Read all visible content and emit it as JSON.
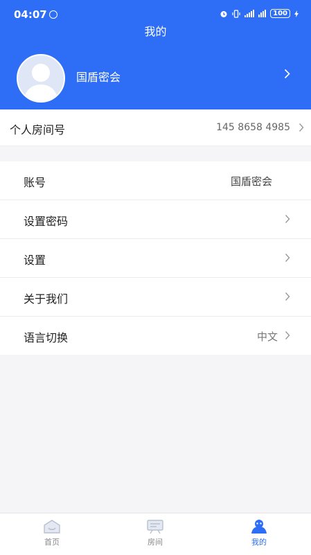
{
  "status_bar": {
    "time": "04:07",
    "battery": "100"
  },
  "header": {
    "title": "我的"
  },
  "profile": {
    "name": "国盾密会"
  },
  "room": {
    "label": "个人房间号",
    "value": "145 8658 4985"
  },
  "settings": [
    {
      "label": "账号",
      "value": "国盾密会"
    },
    {
      "label": "设置密码"
    },
    {
      "label": "设置"
    },
    {
      "label": "关于我们"
    },
    {
      "label": "语言切换",
      "value": "中文"
    }
  ],
  "tabbar": [
    {
      "label": "首页",
      "icon": "home-icon",
      "active": false
    },
    {
      "label": "房间",
      "icon": "room-icon",
      "active": false
    },
    {
      "label": "我的",
      "icon": "profile-icon",
      "active": true
    }
  ],
  "colors": {
    "accent": "#2e6df6",
    "background": "#f5f5f7"
  }
}
